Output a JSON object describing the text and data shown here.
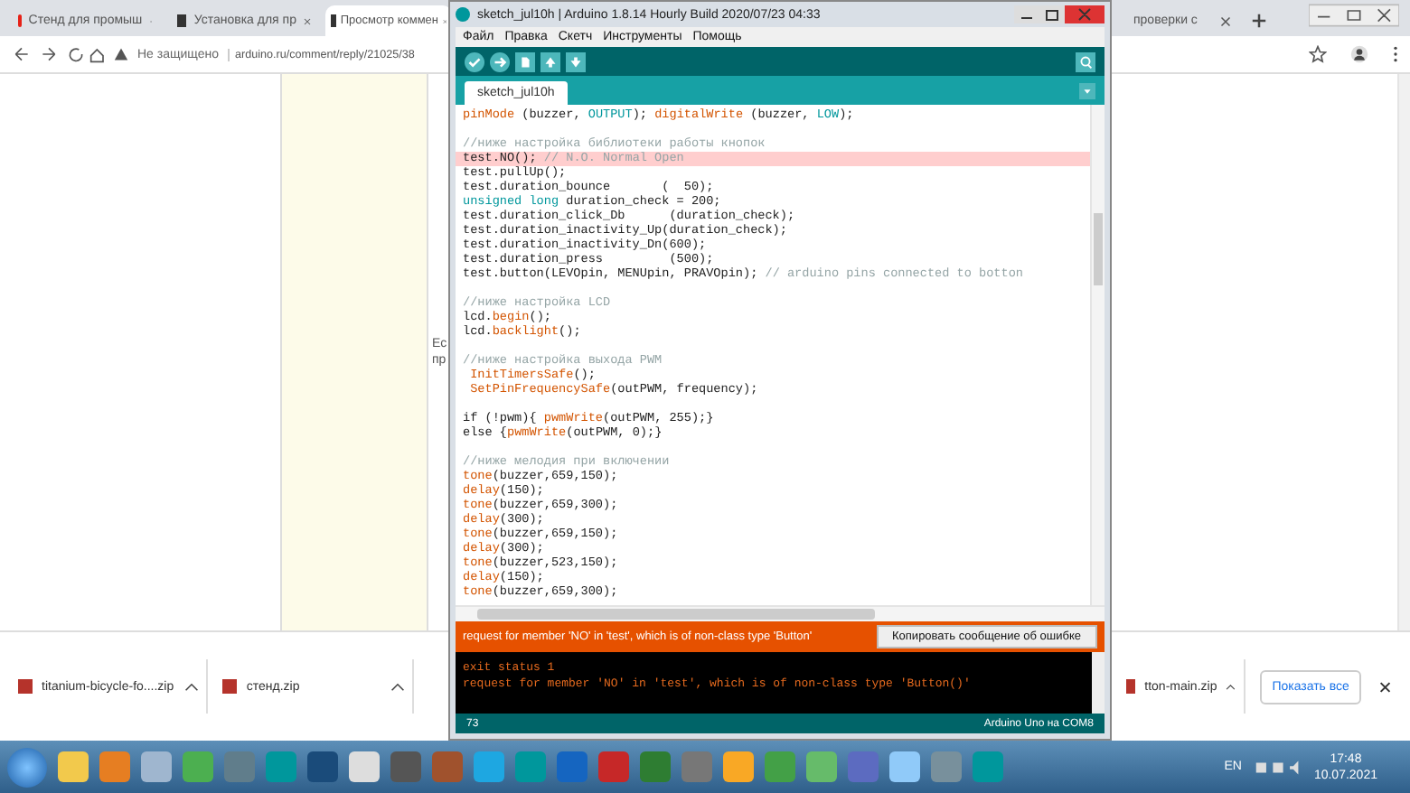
{
  "browser": {
    "tabs": [
      {
        "title": "Стенд для промыш",
        "selected": false,
        "kind": "video"
      },
      {
        "title": "Установка для пр",
        "selected": false,
        "kind": "site"
      },
      {
        "title": "Просмотр коммен",
        "selected": true,
        "kind": "site"
      },
      {
        "title": "проверки с",
        "selected": false,
        "kind": "plain"
      }
    ],
    "security": "Не защищено",
    "url": "arduino.ru/comment/reply/21025/38",
    "page_fragments": [
      "Ес",
      "пр"
    ]
  },
  "ide": {
    "title": "sketch_jul10h | Arduino 1.8.14 Hourly Build 2020/07/23 04:33",
    "menu": [
      "Файл",
      "Правка",
      "Скетч",
      "Инструменты",
      "Помощь"
    ],
    "tab": "sketch_jul10h",
    "code": [
      {
        "highlighted": false,
        "tokens": [
          {
            "text": "pinMode",
            "kind": "fn"
          },
          {
            "text": " (buzzer, ",
            "kind": "plain"
          },
          {
            "text": "OUTPUT",
            "kind": "const"
          },
          {
            "text": "); ",
            "kind": "plain"
          },
          {
            "text": "digitalWrite",
            "kind": "fn"
          },
          {
            "text": " (buzzer, ",
            "kind": "plain"
          },
          {
            "text": "LOW",
            "kind": "const"
          },
          {
            "text": ");",
            "kind": "plain"
          }
        ]
      },
      {
        "highlighted": false,
        "space_before": true,
        "tokens": [
          {
            "text": "//ниже настройка библиотеки работы кнопок",
            "kind": "comment"
          }
        ]
      },
      {
        "highlighted": true,
        "tokens": [
          {
            "text": "test.NO(); ",
            "kind": "plain"
          },
          {
            "text": "// N.O. Normal Open",
            "kind": "comment"
          }
        ]
      },
      {
        "highlighted": false,
        "tokens": [
          {
            "text": "test.pullUp();",
            "kind": "plain"
          }
        ]
      },
      {
        "highlighted": false,
        "tokens": [
          {
            "text": "test.duration_bounce       (  50);",
            "kind": "plain"
          }
        ]
      },
      {
        "highlighted": false,
        "tokens": [
          {
            "text": "unsigned long",
            "kind": "const"
          },
          {
            "text": " duration_check = 200;",
            "kind": "plain"
          }
        ]
      },
      {
        "highlighted": false,
        "tokens": [
          {
            "text": "test.duration_click_Db      (duration_check);",
            "kind": "plain"
          }
        ]
      },
      {
        "highlighted": false,
        "tokens": [
          {
            "text": "test.duration_inactivity_Up(duration_check);",
            "kind": "plain"
          }
        ]
      },
      {
        "highlighted": false,
        "tokens": [
          {
            "text": "test.duration_inactivity_Dn(600);",
            "kind": "plain"
          }
        ]
      },
      {
        "highlighted": false,
        "tokens": [
          {
            "text": "test.duration_press         (500);",
            "kind": "plain"
          }
        ]
      },
      {
        "highlighted": false,
        "tokens": [
          {
            "text": "test.button(LEVOpin, MENUpin, PRAVOpin); ",
            "kind": "plain"
          },
          {
            "text": "// arduino pins connected to botton",
            "kind": "comment"
          }
        ]
      },
      {
        "highlighted": false,
        "space_before": true,
        "tokens": [
          {
            "text": "//ниже настройка LCD",
            "kind": "comment"
          }
        ]
      },
      {
        "highlighted": false,
        "tokens": [
          {
            "text": "lcd.",
            "kind": "plain"
          },
          {
            "text": "begin",
            "kind": "fn"
          },
          {
            "text": "();",
            "kind": "plain"
          }
        ]
      },
      {
        "highlighted": false,
        "tokens": [
          {
            "text": "lcd.",
            "kind": "plain"
          },
          {
            "text": "backlight",
            "kind": "fn"
          },
          {
            "text": "();",
            "kind": "plain"
          }
        ]
      },
      {
        "highlighted": false,
        "space_before": true,
        "tokens": [
          {
            "text": "//ниже настройка выхода PWM",
            "kind": "comment"
          }
        ]
      },
      {
        "highlighted": false,
        "tokens": [
          {
            "text": " InitTimersSafe",
            "kind": "fn"
          },
          {
            "text": "();",
            "kind": "plain"
          }
        ]
      },
      {
        "highlighted": false,
        "tokens": [
          {
            "text": " SetPinFrequencySafe",
            "kind": "fn"
          },
          {
            "text": "(outPWM, frequency);",
            "kind": "plain"
          }
        ]
      },
      {
        "highlighted": false,
        "space_before": true,
        "tokens": [
          {
            "text": "if (!pwm){ ",
            "kind": "plain"
          },
          {
            "text": "pwmWrite",
            "kind": "fn"
          },
          {
            "text": "(outPWM, 255);}",
            "kind": "plain"
          }
        ]
      },
      {
        "highlighted": false,
        "tokens": [
          {
            "text": "else {",
            "kind": "plain"
          },
          {
            "text": "pwmWrite",
            "kind": "fn"
          },
          {
            "text": "(outPWM, 0);}",
            "kind": "plain"
          }
        ]
      },
      {
        "highlighted": false,
        "space_before": true,
        "tokens": [
          {
            "text": "//ниже мелодия при включении",
            "kind": "comment"
          }
        ]
      },
      {
        "highlighted": false,
        "tokens": [
          {
            "text": "tone",
            "kind": "fn"
          },
          {
            "text": "(buzzer,659,150);",
            "kind": "plain"
          }
        ]
      },
      {
        "highlighted": false,
        "tokens": [
          {
            "text": "delay",
            "kind": "fn"
          },
          {
            "text": "(150);",
            "kind": "plain"
          }
        ]
      },
      {
        "highlighted": false,
        "tokens": [
          {
            "text": "tone",
            "kind": "fn"
          },
          {
            "text": "(buzzer,659,300);",
            "kind": "plain"
          }
        ]
      },
      {
        "highlighted": false,
        "tokens": [
          {
            "text": "delay",
            "kind": "fn"
          },
          {
            "text": "(300);",
            "kind": "plain"
          }
        ]
      },
      {
        "highlighted": false,
        "tokens": [
          {
            "text": "tone",
            "kind": "fn"
          },
          {
            "text": "(buzzer,659,150);",
            "kind": "plain"
          }
        ]
      },
      {
        "highlighted": false,
        "tokens": [
          {
            "text": "delay",
            "kind": "fn"
          },
          {
            "text": "(300);",
            "kind": "plain"
          }
        ]
      },
      {
        "highlighted": false,
        "tokens": [
          {
            "text": "tone",
            "kind": "fn"
          },
          {
            "text": "(buzzer,523,150);",
            "kind": "plain"
          }
        ]
      },
      {
        "highlighted": false,
        "tokens": [
          {
            "text": "delay",
            "kind": "fn"
          },
          {
            "text": "(150);",
            "kind": "plain"
          }
        ]
      },
      {
        "highlighted": false,
        "tokens": [
          {
            "text": "tone",
            "kind": "fn"
          },
          {
            "text": "(buzzer,659,300);",
            "kind": "plain"
          }
        ]
      }
    ],
    "error_message": "request for member 'NO' in 'test', which is of non-class type 'Button'",
    "copy_button": "Копировать сообщение об ошибке",
    "console": [
      "exit status 1",
      "request for member 'NO' in 'test', which is of non-class type 'Button()'"
    ],
    "status_line": "73",
    "status_board": "Arduino Uno на COM8"
  },
  "downloads": {
    "items": [
      "titanium-bicycle-fo....zip",
      "стенд.zip",
      "tton-main.zip"
    ],
    "show_all": "Показать все"
  },
  "taskbar": {
    "language": "EN",
    "time": "17:48",
    "date": "10.07.2021"
  }
}
